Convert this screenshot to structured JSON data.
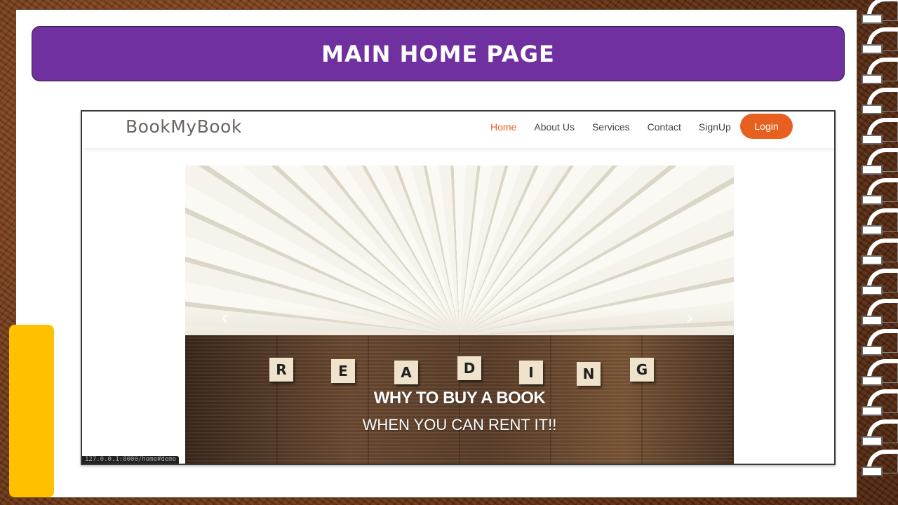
{
  "slide": {
    "title": "MAIN HOME PAGE",
    "accent_color": "#7030a0",
    "tab_color": "#ffc000"
  },
  "website": {
    "brand": "BookMyBook",
    "nav": {
      "items": [
        {
          "label": "Home",
          "active": true
        },
        {
          "label": "About Us",
          "active": false
        },
        {
          "label": "Services",
          "active": false
        },
        {
          "label": "Contact",
          "active": false
        },
        {
          "label": "SignUp",
          "active": false
        }
      ],
      "login_label": "Login",
      "accent_color": "#e8601f"
    },
    "hero": {
      "tiles": [
        "R",
        "E",
        "A",
        "D",
        "I",
        "N",
        "G"
      ],
      "headline": "WHY TO BUY A BOOK",
      "subheadline": "WHEN YOU CAN RENT IT!!",
      "prev_icon": "chevron-left-icon",
      "next_icon": "chevron-right-icon"
    },
    "status_url": "127.0.0.1:8000/home#demo"
  }
}
